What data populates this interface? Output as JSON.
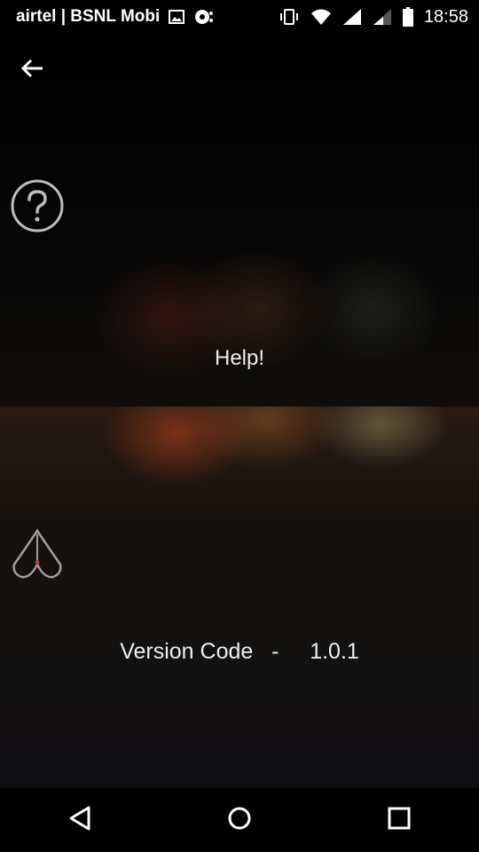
{
  "status_bar": {
    "carrier": "airtel | BSNL Mobi",
    "time": "18:58",
    "icons": [
      "image-icon",
      "sync-icon",
      "vibrate-icon",
      "wifi-icon",
      "signal-icon",
      "signal-weak-icon",
      "battery-icon"
    ]
  },
  "toolbar": {
    "back_icon": "back-arrow-icon"
  },
  "help": {
    "icon": "help-circle-icon",
    "label": "Help!"
  },
  "about": {
    "icon": "kite-logo-icon",
    "version_label": "Version Code",
    "separator": "-",
    "version_value": "1.0.1"
  },
  "nav_bar": {
    "buttons": [
      "back-triangle-icon",
      "home-circle-icon",
      "recents-square-icon"
    ]
  },
  "colors": {
    "background": "#000000",
    "text": "#eeeeee",
    "accent_red": "#c0392b"
  }
}
